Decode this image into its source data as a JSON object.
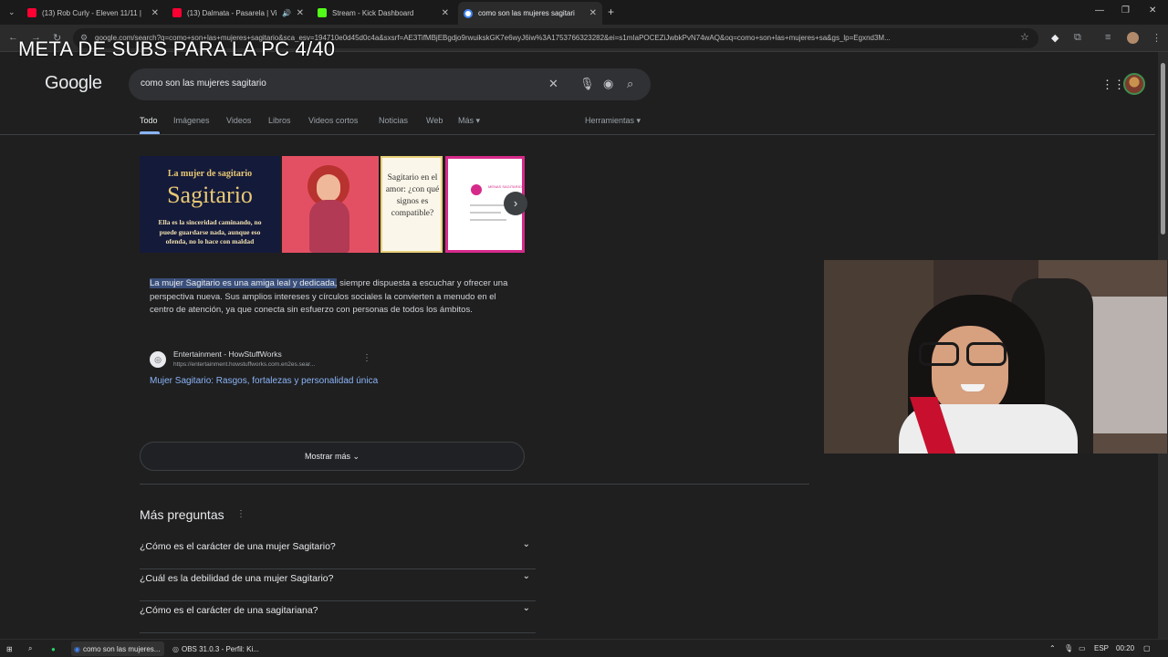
{
  "overlay_title": "META DE SUBS PARA LA PC 4/40",
  "browser": {
    "tabs": [
      {
        "label": "(13) Rob Curly - Eleven 11/11 |",
        "icon": "youtube-icon",
        "color": "#ff0033"
      },
      {
        "label": "(13) Dalmata - Pasarela | Vi",
        "icon": "youtube-icon",
        "color": "#ff0033"
      },
      {
        "label": "Stream - Kick Dashboard",
        "icon": "kick-icon",
        "color": "#53fc18"
      },
      {
        "label": "como son las mujeres sagitario",
        "icon": "google-icon",
        "color": "#4285f4"
      }
    ],
    "url": "google.com/search?q=como+son+las+mujeres+sagitario&sca_esv=194710e0d45d0c4a&sxsrf=AE3TifMBjEBgdjo9rwuikskGK7e6wyJ6iw%3A1753766323282&ei=s1mIaPOCEZiJwbkPvN74wAQ&oq=como+son+las+mujeres+sa&gs_lp=Egxnd3M..."
  },
  "google": {
    "logo": "Google",
    "query": "como son las mujeres sagitario",
    "nav_tabs": [
      "Todo",
      "Imágenes",
      "Videos",
      "Libros",
      "Videos cortos",
      "Noticias",
      "Web",
      "Más ▾"
    ],
    "tools": "Herramientas ▾",
    "images": {
      "img1_title": "La mujer de sagitario",
      "img1_big": "Sagitario",
      "img1_caption": "Ella es la sinceridad caminando, no puede guardarse nada, aunque eso ofenda, no lo hace con maldad",
      "img3_text": "Sagitario en el amor: ¿con qué signos es compatible?",
      "img4_text": "MENAS SAGITARIO"
    },
    "snippet": {
      "highlight": "La mujer Sagitario es una amiga leal y dedicada,",
      "text": " siempre dispuesta a escuchar y ofrecer una perspectiva nueva. Sus amplios intereses y círculos sociales la convierten a menudo en el centro de atención, ya que conecta sin esfuerzo con personas de todos los ámbitos.",
      "source_name": "Entertainment - HowStuffWorks",
      "source_url": "https://entertainment.howstuffworks.com.en2es.sear...",
      "link": "Mujer Sagitario: Rasgos, fortalezas y personalidad única"
    },
    "show_more": "Mostrar más",
    "paa_title": "Más preguntas",
    "paa": [
      "¿Cómo es el carácter de una mujer Sagitario?",
      "¿Cuál es la debilidad de una mujer Sagitario?",
      "¿Cómo es el carácter de una sagitariana?"
    ]
  },
  "taskbar": {
    "items": [
      "como son las mujeres...",
      "OBS 31.0.3 - Perfil: Ki..."
    ],
    "lang": "ESP",
    "time": "00:20"
  }
}
